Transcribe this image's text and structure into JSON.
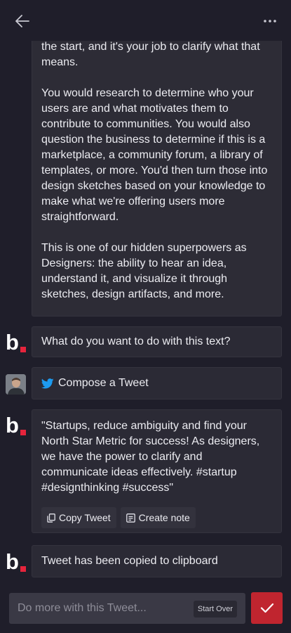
{
  "header": {
    "back_icon": "arrow-left-icon",
    "more_icon": "more-horizontal-icon"
  },
  "messages": {
    "article": {
      "paragraphs": [
        "the start, and it's your job to clarify what that means.",
        "You would research to determine who your users are and what motivates them to contribute to communities. You would also question the business to determine if this is a marketplace, a community forum, a library of templates, or more. You'd then turn those into design sketches based on your knowledge to make what we're offering users more straightforward.",
        "This is one of our hidden superpowers as Designers: the ability to hear an idea, understand it, and visualize it through sketches, design artifacts, and more."
      ]
    },
    "prompt": "What do you want to do with this text?",
    "user_choice": "Compose a Tweet",
    "tweet": "\"Startups, reduce ambiguity and find your North Star Metric for success! As designers, we have the power to clarify and communicate ideas effectively. #startup #designthinking #success\"",
    "copy_label": "Copy Tweet",
    "note_label": "Create note",
    "copied_status": "Tweet has been copied to clipboard"
  },
  "composer": {
    "placeholder": "Do more with this Tweet...",
    "start_over": "Start Over"
  },
  "colors": {
    "background": "#1f1e2a",
    "card": "#2b2a35",
    "accent": "#c0252f",
    "twitter": "#1d9bf0"
  }
}
